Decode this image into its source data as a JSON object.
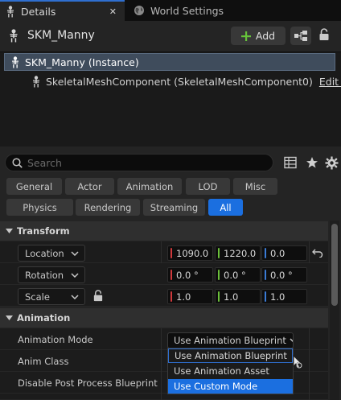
{
  "tabs": [
    {
      "label": "Details",
      "close": "✕"
    },
    {
      "label": "World Settings"
    }
  ],
  "header": {
    "actor_name": "SKM_Manny",
    "add_label": "Add"
  },
  "tree": {
    "instance_label": "SKM_Manny (Instance)",
    "component_label": "SkeletalMeshComponent (SkeletalMeshComponent0)",
    "edit_link": "Edit in C++"
  },
  "search": {
    "placeholder": "Search",
    "value": ""
  },
  "filters": {
    "row1": [
      "General",
      "Actor",
      "Animation",
      "LOD",
      "Misc"
    ],
    "row2": [
      "Physics",
      "Rendering",
      "Streaming",
      "All"
    ],
    "active": "All"
  },
  "transform": {
    "title": "Transform",
    "location": {
      "label": "Location",
      "x": "1090.0",
      "y": "1220.0",
      "z": "0.0"
    },
    "rotation": {
      "label": "Rotation",
      "x": "0.0 °",
      "y": "0.0 °",
      "z": "0.0 °"
    },
    "scale": {
      "label": "Scale",
      "x": "1.0",
      "y": "1.0",
      "z": "1.0"
    }
  },
  "animation": {
    "title": "Animation",
    "mode_label": "Animation Mode",
    "mode_value": "Use Animation Blueprint",
    "anim_class_label": "Anim Class",
    "disable_pp_label": "Disable Post Process Blueprint",
    "options": [
      "Use Animation Blueprint",
      "Use Animation Asset",
      "Use Custom Mode"
    ],
    "highlighted_option": "Use Custom Mode"
  },
  "colors": {
    "accent": "#1b6fe0",
    "axis_x": "#d0393c",
    "axis_y": "#6bbf3a",
    "axis_z": "#3a7bd5",
    "add_plus": "#66c23a"
  },
  "icons": [
    "skeleton-icon",
    "globe-icon",
    "plus-icon",
    "blueprint-icon",
    "lock-icon",
    "search-icon",
    "table-icon",
    "star-icon",
    "gear-icon",
    "reset-arrow-icon",
    "chevron-down-icon",
    "triangle-down-icon",
    "cursor-icon"
  ]
}
